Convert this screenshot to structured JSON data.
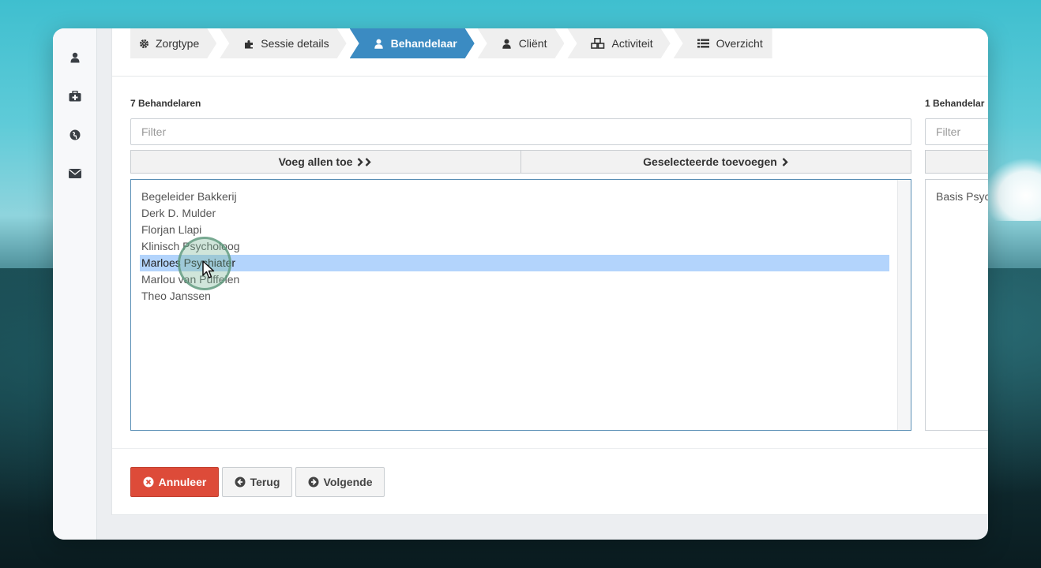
{
  "steps": [
    {
      "label": "Zorgtype",
      "icon": "gear-icon"
    },
    {
      "label": "Sessie details",
      "icon": "puzzle-icon"
    },
    {
      "label": "Behandelaar",
      "icon": "user-icon",
      "active": true
    },
    {
      "label": "Cliënt",
      "icon": "user-icon"
    },
    {
      "label": "Activiteit",
      "icon": "cubes-icon"
    },
    {
      "label": "Overzicht",
      "icon": "list-icon"
    }
  ],
  "sidebar": {
    "icons": [
      "user-icon",
      "medkit-icon",
      "globe-icon",
      "envelope-icon"
    ]
  },
  "available": {
    "count_label": "7 Behandelaren",
    "filter_placeholder": "Filter",
    "add_all_label": "Voeg allen toe",
    "add_selected_label": "Geselecteerde toevoegen",
    "items": [
      "Begeleider Bakkerij",
      "Derk D. Mulder",
      "Florjan Llapi",
      "Klinisch Psycholoog",
      "Marloes Psychiater",
      "Marlou van Puffelen",
      "Theo Janssen"
    ],
    "selected_item": "Marloes Psychiater"
  },
  "chosen": {
    "count_label": "1 Behandelar",
    "filter_placeholder": "Filter",
    "items": [
      "Basis Psyc"
    ]
  },
  "actions": {
    "cancel_label": "Annuleer",
    "back_label": "Terug",
    "next_label": "Volgende"
  },
  "colors": {
    "accent": "#3b8bc2",
    "danger": "#dd4b39",
    "selection": "#b3d4fc"
  }
}
